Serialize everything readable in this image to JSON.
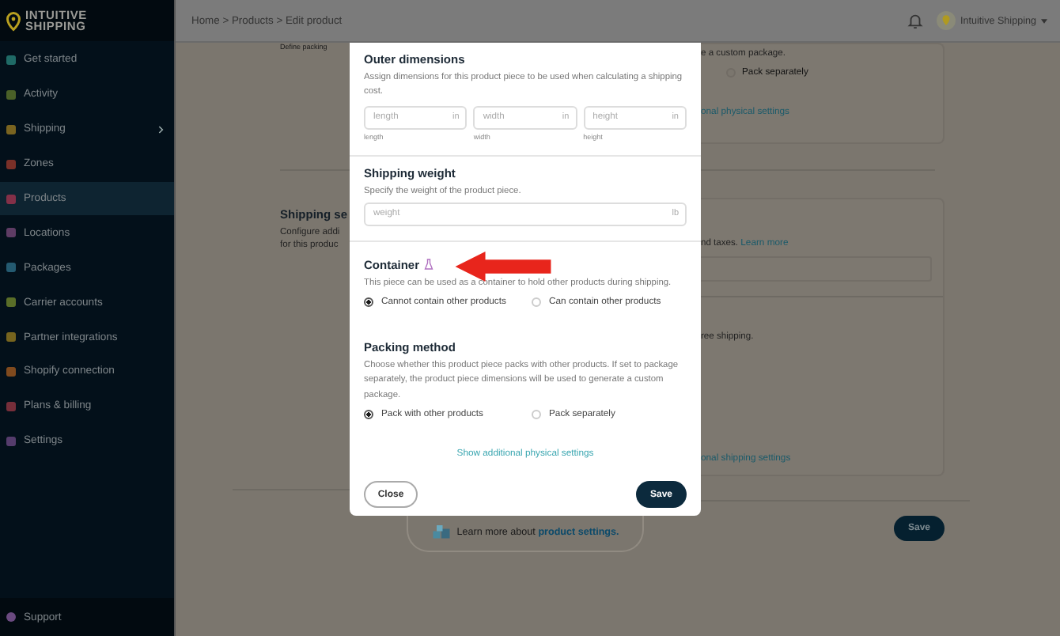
{
  "sidebar": {
    "logo": [
      "INTUITIVE",
      "SHIPPING"
    ],
    "items": [
      {
        "label": "Get started",
        "color": "#1f6a66",
        "selected": false,
        "submenu": false
      },
      {
        "label": "Activity",
        "color": "#4a6028",
        "selected": false,
        "submenu": false
      },
      {
        "label": "Shipping",
        "color": "#7a6420",
        "selected": false,
        "submenu": true
      },
      {
        "label": "Zones",
        "color": "#7a3028",
        "selected": false,
        "submenu": false
      },
      {
        "label": "Products",
        "color": "#843048",
        "selected": true,
        "submenu": false
      },
      {
        "label": "Locations",
        "color": "#5e3c64",
        "selected": false,
        "submenu": false
      },
      {
        "label": "Packages",
        "color": "#245a70",
        "selected": false,
        "submenu": false
      },
      {
        "label": "Carrier accounts",
        "color": "#5a6e28",
        "selected": false,
        "submenu": false
      },
      {
        "label": "Partner integrations",
        "color": "#76641e",
        "selected": false,
        "submenu": false
      },
      {
        "label": "Shopify connection",
        "color": "#804a1e",
        "selected": false,
        "submenu": false
      },
      {
        "label": "Plans & billing",
        "color": "#762e3a",
        "selected": false,
        "submenu": false
      },
      {
        "label": "Settings",
        "color": "#553c6c",
        "selected": false,
        "submenu": false
      }
    ],
    "support": "Support"
  },
  "topbar": {
    "breadcrumb": "Home > Products > Edit product",
    "account": "Intuitive Shipping"
  },
  "background": {
    "left": {
      "cut_text": "Define packing",
      "title": "Shipping se",
      "lines": [
        "Configure addi",
        "for this produc"
      ]
    },
    "right": {
      "package_text": "e a custom package.",
      "radio": {
        "label": "Pack separately",
        "selected": false
      },
      "physical_link": "onal physical settings",
      "taxes_text": "nd taxes.",
      "learn_more": "Learn more",
      "free_shipping": "ree shipping.",
      "shipping_link": "onal shipping settings",
      "save": "Save"
    }
  },
  "modal": {
    "outer": {
      "title": "Outer dimensions",
      "description": "Assign dimensions for this product piece to be used when calculating a shipping cost.",
      "fields": [
        {
          "placeholder": "length",
          "unit": "in",
          "caption": "length"
        },
        {
          "placeholder": "width",
          "unit": "in",
          "caption": "width"
        },
        {
          "placeholder": "height",
          "unit": "in",
          "caption": "height"
        }
      ]
    },
    "weight": {
      "title": "Shipping weight",
      "description": "Specify the weight of the product piece.",
      "placeholder": "weight",
      "unit": "lb"
    },
    "container": {
      "title": "Container",
      "description": "This piece can be used as a container to hold other products during shipping.",
      "options": [
        {
          "label": "Cannot contain other products",
          "selected": true
        },
        {
          "label": "Can contain other products",
          "selected": false
        }
      ]
    },
    "packing": {
      "title": "Packing method",
      "description": "Choose whether this product piece packs with other products. If set to package separately, the product piece dimensions will be used to generate a custom package.",
      "options": [
        {
          "label": "Pack with other products",
          "selected": true
        },
        {
          "label": "Pack separately",
          "selected": false
        }
      ]
    },
    "link": "Show additional physical settings",
    "close": "Close",
    "save": "Save"
  },
  "help": {
    "text": "Learn more about",
    "link": "product settings."
  }
}
